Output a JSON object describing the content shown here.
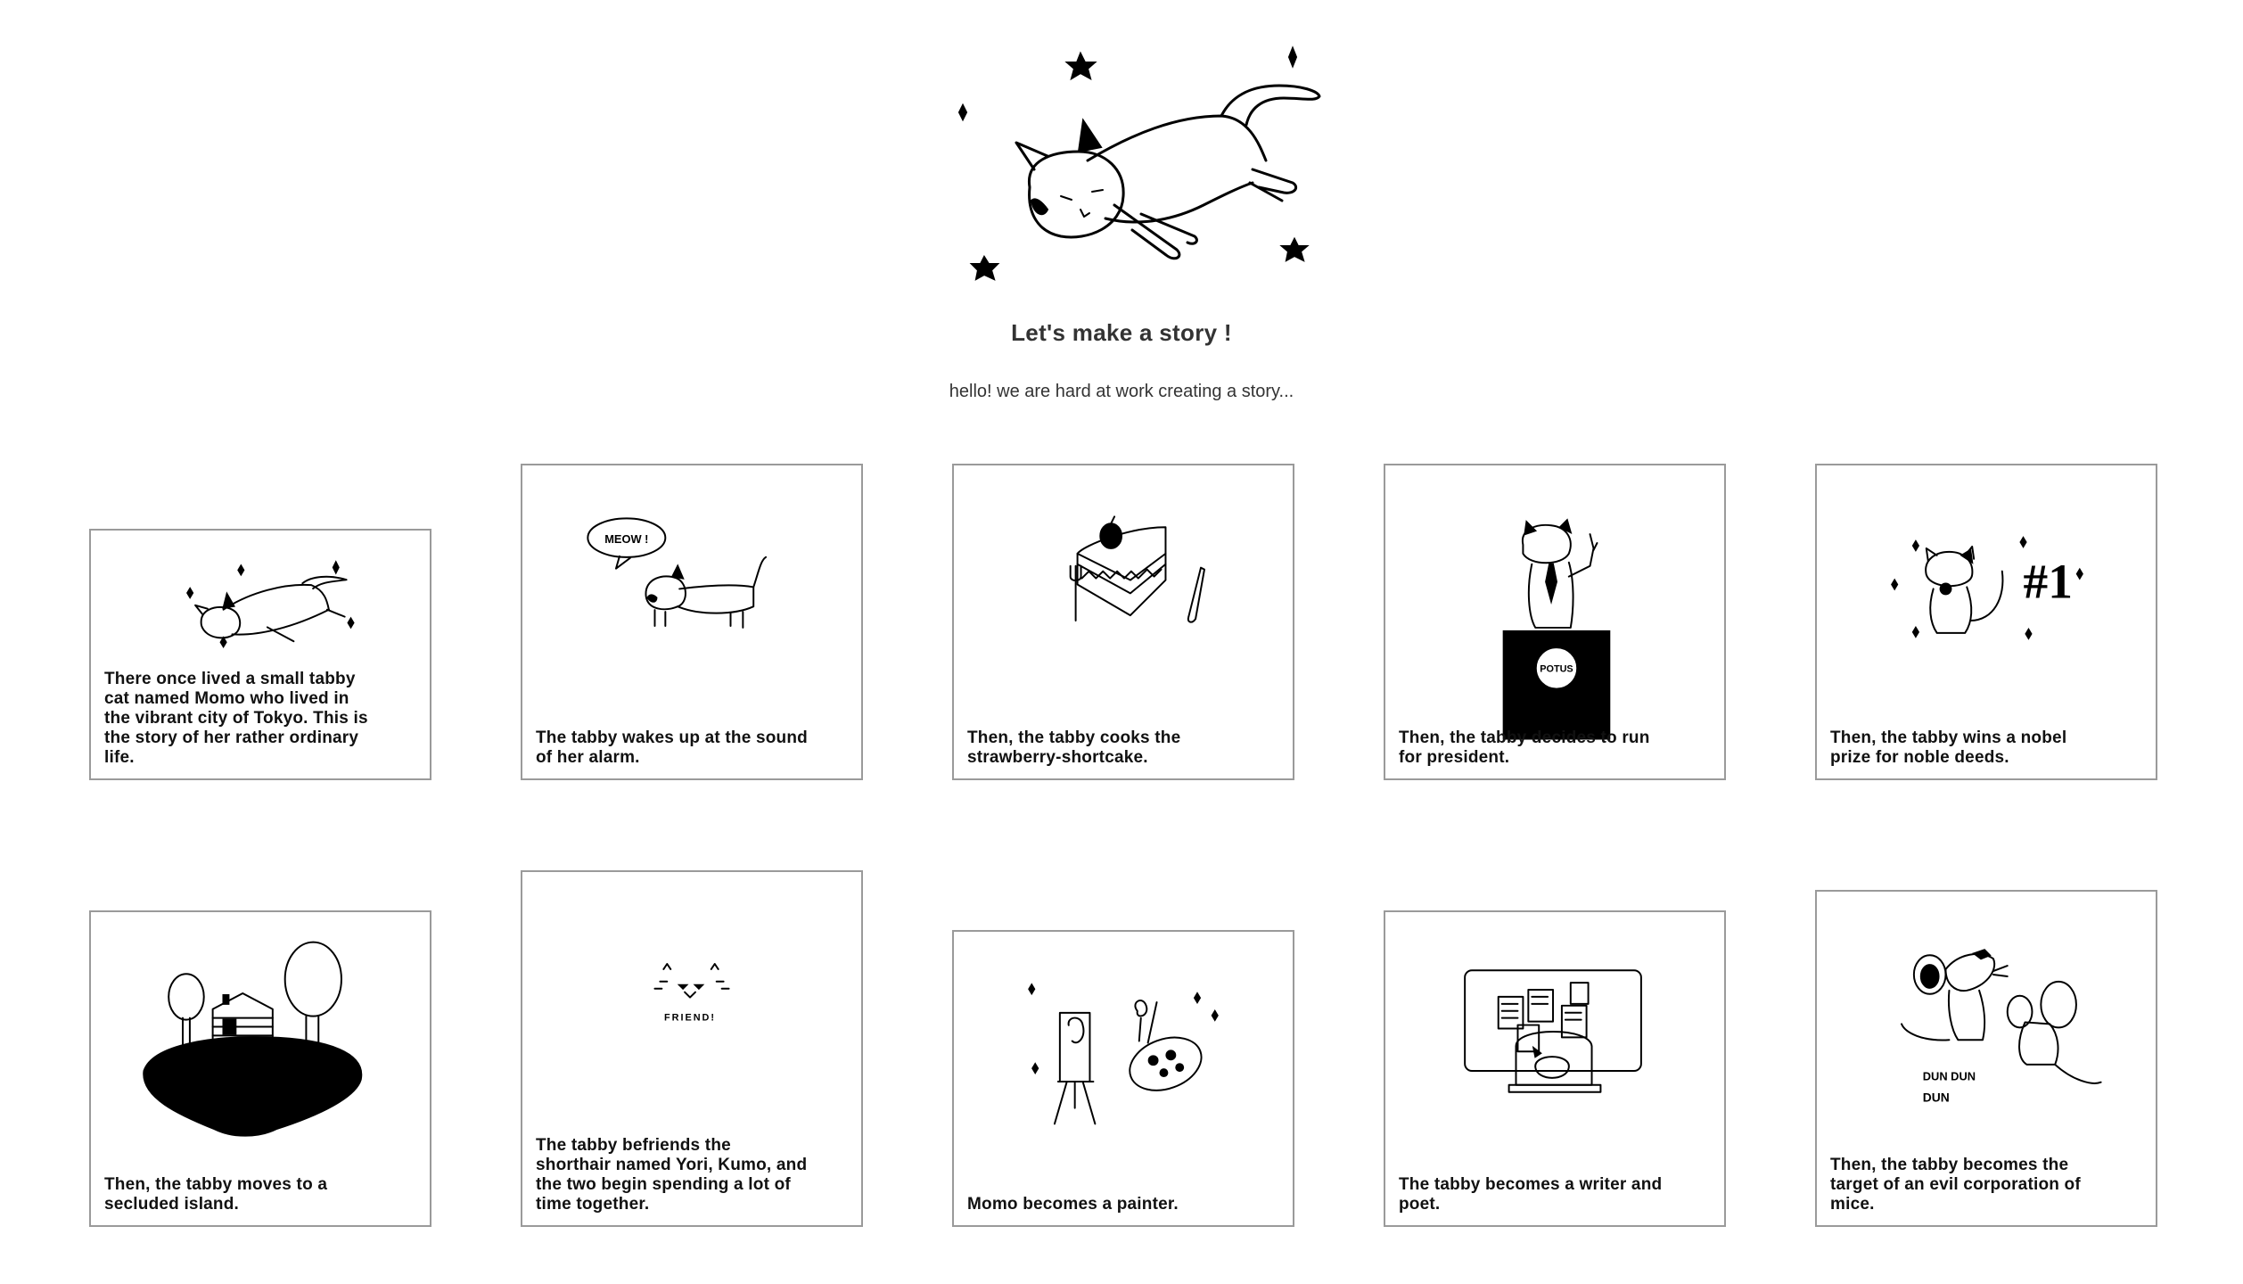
{
  "header": {
    "title": "Let's make a story !",
    "subtitle": "hello! we are hard at work creating a story..."
  },
  "cards": [
    {
      "caption": "There once lived a small tabby cat named Momo who lived in the vibrant city of Tokyo. This is the story of her rather ordinary life.",
      "illustration": "flying-cat-stars"
    },
    {
      "caption": "The tabby wakes up at the sound of her alarm.",
      "illustration": "cat-meow"
    },
    {
      "caption": "Then, the tabby cooks the strawberry-shortcake.",
      "illustration": "strawberry-shortcake"
    },
    {
      "caption": "Then, the tabby decides to run for president.",
      "illustration": "cat-podium"
    },
    {
      "caption": "Then, the tabby wins a nobel prize for noble deeds.",
      "illustration": "cat-number-one"
    },
    {
      "caption": "Then, the tabby moves to a secluded island.",
      "illustration": "island-house"
    },
    {
      "caption": "The tabby befriends the shorthair named Yori, Kumo, and the two begin spending a lot of time together.",
      "illustration": "cat-face-friend"
    },
    {
      "caption": "Momo becomes a painter.",
      "illustration": "easel-palette"
    },
    {
      "caption": "The tabby becomes a writer and poet.",
      "illustration": "cat-desk-board"
    },
    {
      "caption": "Then, the tabby becomes the target of an evil corporation of mice.",
      "illustration": "mice"
    }
  ],
  "art_text": {
    "meow": "MEOW !",
    "potus": "POTUS",
    "number_one": "#1",
    "friend": "FRIEND!",
    "dun_dun": "DUN DUN",
    "dun": "DUN"
  }
}
